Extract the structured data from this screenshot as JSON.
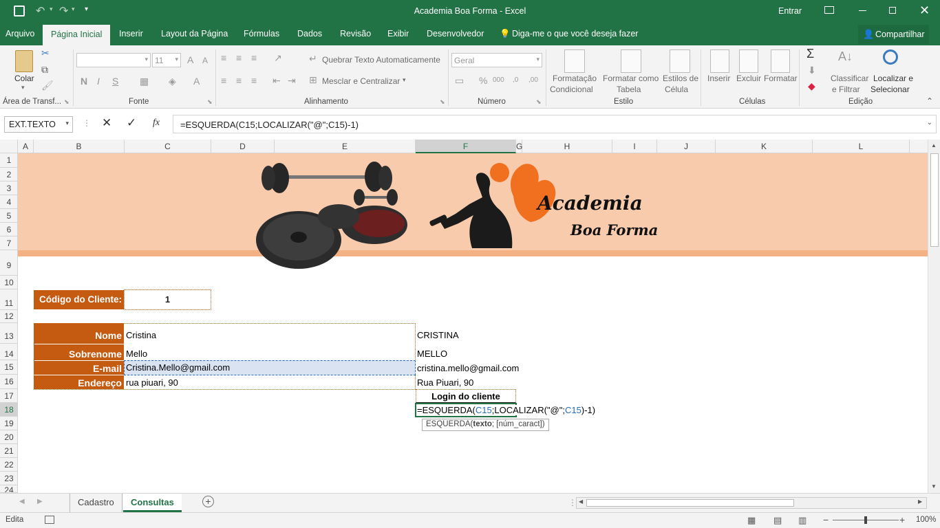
{
  "window": {
    "title": "Academia Boa Forma  -  Excel",
    "signin": "Entrar"
  },
  "tabs": [
    "Arquivo",
    "Página Inicial",
    "Inserir",
    "Layout da Página",
    "Fórmulas",
    "Dados",
    "Revisão",
    "Exibir",
    "Desenvolvedor"
  ],
  "tellme": "Diga-me o que você deseja fazer",
  "share": "Compartilhar",
  "ribbon": {
    "paste": "Colar",
    "clipboard_group": "Área de Transf...",
    "font_group": "Fonte",
    "font_size": "11",
    "bold": "N",
    "italic": "I",
    "underline": "S",
    "wrap_text": "Quebrar Texto Automaticamente",
    "merge_center": "Mesclar e Centralizar",
    "align_group": "Alinhamento",
    "number_format": "Geral",
    "number_group": "Número",
    "cond_format_1": "Formatação",
    "cond_format_2": "Condicional",
    "format_table_1": "Formatar como",
    "format_table_2": "Tabela",
    "cell_styles_1": "Estilos de",
    "cell_styles_2": "Célula",
    "styles_group": "Estilo",
    "insert": "Inserir",
    "delete": "Excluir",
    "format": "Formatar",
    "cells_group": "Células",
    "sort_1": "Classificar",
    "sort_2": "e Filtrar",
    "find_1": "Localizar e",
    "find_2": "Selecionar",
    "edit_group": "Edição"
  },
  "formula_bar": {
    "name_box": "EXT.TEXTO",
    "formula": "=ESQUERDA(C15;LOCALIZAR(\"@\";C15)-1)"
  },
  "columns": [
    "A",
    "B",
    "C",
    "D",
    "E",
    "F",
    "G",
    "H",
    "I",
    "J",
    "K",
    "L"
  ],
  "rows": [
    "1",
    "2",
    "3",
    "4",
    "5",
    "6",
    "7",
    "9",
    "10",
    "11",
    "12",
    "13",
    "14",
    "15",
    "16",
    "17",
    "18",
    "19",
    "20",
    "21",
    "22",
    "23",
    "24"
  ],
  "banner": {
    "line1": "Academia",
    "line2": "Boa Forma",
    "bg": "#f8cbad",
    "stripe": "#f4b183"
  },
  "sheet": {
    "client_code_label": "Código do Cliente:",
    "client_code": "1",
    "labels": [
      "Nome",
      "Sobrenome",
      "E-mail",
      "Endereço"
    ],
    "values": [
      "Cristina",
      "Mello",
      "Cristina.Mello@gmail.com",
      "rua piuari, 90"
    ],
    "results": [
      "CRISTINA",
      "MELLO",
      "cristina.mello@gmail.com",
      "Rua Piuari, 90"
    ],
    "login_header": "Login do cliente",
    "edit_formula_pre": "=ESQUERDA(",
    "edit_ref1": "C15",
    "edit_mid": ";LOCALIZAR(",
    "edit_str": "\"@\"",
    "edit_sep": ";",
    "edit_ref2": "C15",
    "edit_post": ")-1)",
    "tooltip_fn": "ESQUERDA(",
    "tooltip_arg": "texto",
    "tooltip_rest": "; [núm_caract])",
    "label_color": "#c55a11"
  },
  "sheets": [
    "Cadastro",
    "Consultas"
  ],
  "status": {
    "mode": "Edita",
    "zoom": "100%"
  }
}
